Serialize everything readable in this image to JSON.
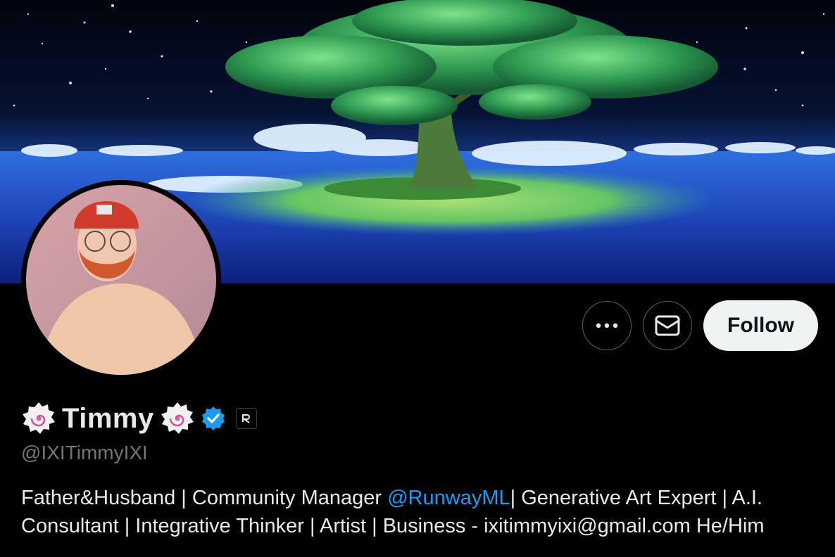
{
  "profile": {
    "display_name": "Timmy",
    "handle": "@IXITimmyIXI",
    "verified": true,
    "name_emoji": "swirl-fishcake-icon",
    "affiliation_badge": "runway-logo-icon"
  },
  "actions": {
    "more_label": "more-options-icon",
    "message_label": "message-icon",
    "follow_label": "Follow"
  },
  "bio": {
    "part1": "Father&Husband | Community Manager ",
    "mention": "@RunwayML",
    "part2": "| Generative Art Expert | A.I. Consultant | Integrative Thinker | Artist | Business - ixitimmyixi@gmail.com He/Him"
  },
  "colors": {
    "background": "#000000",
    "text": "#e7e9ea",
    "muted": "#71767b",
    "accent": "#1d9bf0",
    "verified": "#1d9bf0",
    "follow_bg": "#eff3f4"
  }
}
